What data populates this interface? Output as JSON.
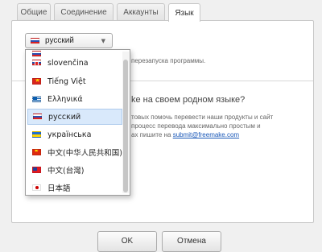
{
  "tabs": [
    {
      "label": "Общие",
      "active": false
    },
    {
      "label": "Соединение",
      "active": false
    },
    {
      "label": "Аккаунты",
      "active": false
    },
    {
      "label": "Язык",
      "active": true
    }
  ],
  "language": {
    "selected": {
      "label": "русский",
      "flag": "ru-flag-icon"
    },
    "dropdown_items": [
      {
        "label": "slovenčina",
        "flag": "sk-flag-icon"
      },
      {
        "label": "Tiếng Việt",
        "flag": "vn-flag-icon"
      },
      {
        "label": "Ελληνικά",
        "flag": "gr-flag-icon"
      },
      {
        "label": "русский",
        "flag": "ru-flag-icon",
        "selected": true
      },
      {
        "label": "українська",
        "flag": "ua-flag-icon"
      },
      {
        "label": "中文(中华人民共和国)",
        "flag": "cn-flag-icon"
      },
      {
        "label": "中文(台灣)",
        "flag": "tw-flag-icon"
      },
      {
        "label": "日本語",
        "flag": "jp-flag-icon"
      }
    ]
  },
  "background": {
    "restart_note": "перезапуска программы.",
    "heading": "ke на своем родном языке?",
    "line1": "товых помочь перевести наши продукты и сайт",
    "line2": "процесс перевода максимально простым и",
    "line3_prefix": "ах пишите на",
    "email": "submit@freemake.com"
  },
  "buttons": {
    "ok": "OK",
    "cancel": "Отмена"
  },
  "colors": {
    "selection": "#d9e9fb",
    "link": "#1a58b8"
  }
}
